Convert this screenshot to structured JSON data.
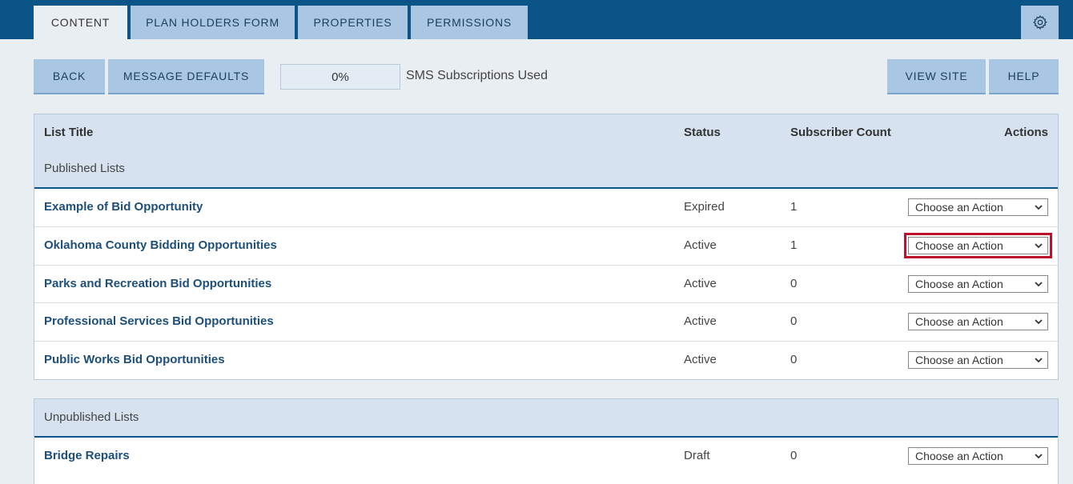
{
  "tabs": [
    {
      "label": "CONTENT",
      "active": true
    },
    {
      "label": "PLAN HOLDERS FORM",
      "active": false
    },
    {
      "label": "PROPERTIES",
      "active": false
    },
    {
      "label": "PERMISSIONS",
      "active": false
    }
  ],
  "settings_icon": "gear-icon",
  "toolbar": {
    "back_label": "BACK",
    "message_defaults_label": "MESSAGE DEFAULTS",
    "sms_progress_value": "0%",
    "sms_progress_fraction": 0,
    "sms_label": "SMS Subscriptions Used",
    "view_site_label": "VIEW SITE",
    "help_label": "HELP"
  },
  "table": {
    "headers": {
      "title": "List Title",
      "status": "Status",
      "count": "Subscriber Count",
      "actions": "Actions"
    },
    "published_label": "Published Lists",
    "published_rows": [
      {
        "title": "Example of Bid Opportunity",
        "status": "Expired",
        "count": "1",
        "action": "Choose an Action"
      },
      {
        "title": "Oklahoma County Bidding Opportunities",
        "status": "Active",
        "count": "1",
        "action": "Choose an Action"
      },
      {
        "title": "Parks and Recreation Bid Opportunities",
        "status": "Active",
        "count": "0",
        "action": "Choose an Action"
      },
      {
        "title": "Professional Services Bid Opportunities",
        "status": "Active",
        "count": "0",
        "action": "Choose an Action"
      },
      {
        "title": "Public Works Bid Opportunities",
        "status": "Active",
        "count": "0",
        "action": "Choose an Action"
      }
    ],
    "unpublished_label": "Unpublished Lists",
    "unpublished_rows": [
      {
        "title": "Bridge Repairs",
        "status": "Draft",
        "count": "0",
        "action": "Choose an Action"
      }
    ]
  },
  "colors": {
    "header_bg": "#0b5487",
    "tab_bg": "#a9c7e3",
    "highlight": "#c0102a"
  }
}
